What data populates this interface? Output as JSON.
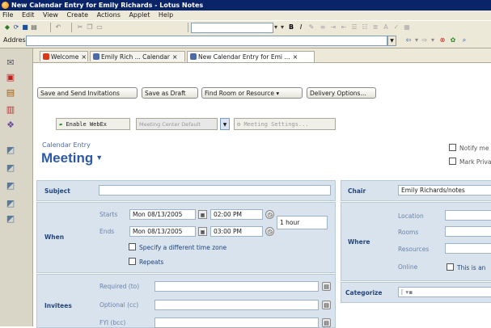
{
  "window": {
    "title": "New Calendar Entry for Emily Richards - Lotus Notes"
  },
  "menu": [
    "File",
    "Edit",
    "View",
    "Create",
    "Actions",
    "Applet",
    "Help"
  ],
  "address": {
    "label": "Address",
    "value": ""
  },
  "tabs": [
    {
      "label": "Welcome",
      "close": "×"
    },
    {
      "label": "Emily Rich ... Calendar",
      "close": "×"
    },
    {
      "label": "New Calendar Entry for Emi ...",
      "close": "×"
    }
  ],
  "actions": [
    "Save and Send Invitations",
    "Save as Draft",
    "Find Room or Resource ▾",
    "Delivery Options..."
  ],
  "webex": {
    "enable": "Enable WebEx",
    "center": "Meeting Center Default",
    "settings": "Meeting Settings..."
  },
  "entry": {
    "subtitle": "Calendar Entry",
    "type": "Meeting"
  },
  "right_checks": [
    "Notify me",
    "Mark Private"
  ],
  "form": {
    "subject_label": "Subject",
    "subject_value": "",
    "when_label": "When",
    "starts_label": "Starts",
    "ends_label": "Ends",
    "start_date": "Mon 08/13/2005",
    "start_time": "02:00 PM",
    "end_date": "Mon 08/13/2005",
    "end_time": "03:00 PM",
    "duration": "1 hour",
    "timezone_label": "Specify a different time zone",
    "repeats_label": "Repeats",
    "invitees_label": "Invitees",
    "required_label": "Required (to)",
    "optional_label": "Optional (cc)",
    "fyi_label": "FYI (bcc)"
  },
  "chair": {
    "label": "Chair",
    "value": "Emily Richards/notes"
  },
  "where": {
    "label": "Where",
    "location": "Location",
    "rooms": "Rooms",
    "resources": "Resources",
    "online": "Online",
    "online_check": "This is an"
  },
  "categorize": {
    "label": "Categorize",
    "value": ""
  },
  "colors": {
    "titlebar": "#0a246a",
    "panel": "#d8e3ee",
    "heading": "#2d5aa8"
  }
}
